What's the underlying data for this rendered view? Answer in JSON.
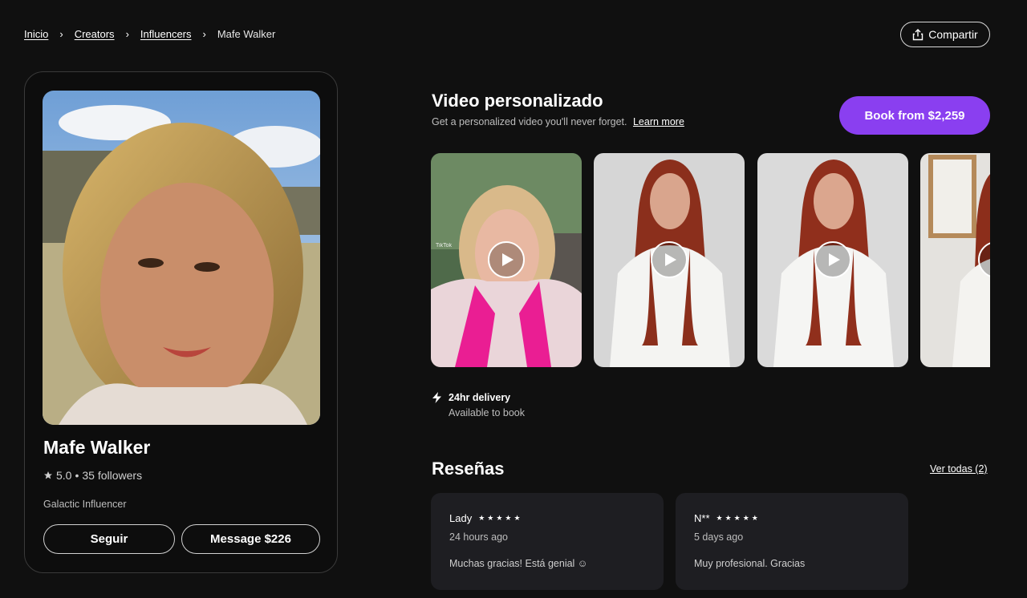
{
  "breadcrumb": {
    "items": [
      "Inicio",
      "Creators",
      "Influencers"
    ],
    "current": "Mafe Walker",
    "separator": "›"
  },
  "share": {
    "label": "Compartir",
    "icon": "share-icon"
  },
  "profile": {
    "name": "Mafe Walker",
    "rating": "5.0",
    "rating_separator": "•",
    "followers": "35 followers",
    "category": "Galactic Influencer",
    "follow_label": "Seguir",
    "message_label": "Message $226"
  },
  "video_section": {
    "title": "Video personalizado",
    "subtitle": "Get a personalized video you'll never forget.",
    "learn_more": "Learn more",
    "book_label": "Book from $2,259",
    "tiktok_label": "TikTok"
  },
  "delivery": {
    "title": "24hr delivery",
    "subtitle": "Available to book",
    "icon": "lightning-icon"
  },
  "reviews": {
    "title": "Reseñas",
    "see_all": "Ver todas (2)",
    "items": [
      {
        "author": "Lady",
        "stars": "★★★★★",
        "time": "24 hours ago",
        "text": "Muchas gracias! Está genial ☺"
      },
      {
        "author": "N**",
        "stars": "★★★★★",
        "time": "5 days ago",
        "text": "Muy profesional. Gracias"
      }
    ]
  },
  "colors": {
    "background": "#101010",
    "accent": "#8a3ff0",
    "card": "#1e1e22"
  }
}
